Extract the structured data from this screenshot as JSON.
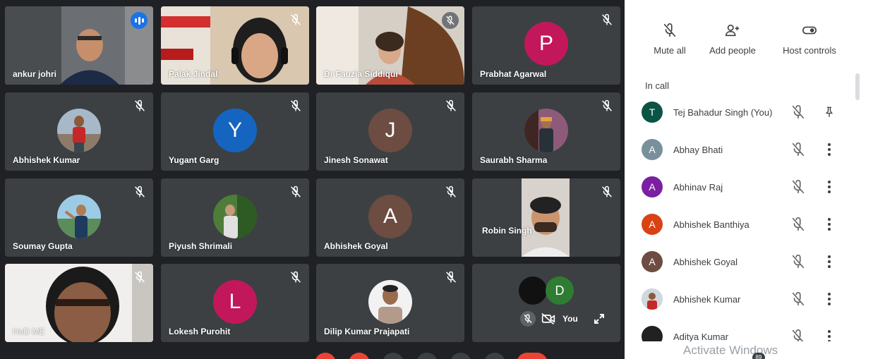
{
  "tiles": [
    {
      "name": "ankur johri",
      "kind": "video",
      "active": true
    },
    {
      "name": "Palak Jindal",
      "kind": "video"
    },
    {
      "name": "Dr Fauzia Siddiqui",
      "kind": "video"
    },
    {
      "name": "Prabhat Agarwal",
      "kind": "letter",
      "letter": "P",
      "color": "#c2185b"
    },
    {
      "name": "Abhishek Kumar",
      "kind": "photo"
    },
    {
      "name": "Yugant Garg",
      "kind": "letter",
      "letter": "Y",
      "color": "#1565c0"
    },
    {
      "name": "Jinesh Sonawat",
      "kind": "letter",
      "letter": "J",
      "color": "#6d4c41"
    },
    {
      "name": "Saurabh Sharma",
      "kind": "photo"
    },
    {
      "name": "Soumay Gupta",
      "kind": "photo"
    },
    {
      "name": "Piyush Shrimali",
      "kind": "photo"
    },
    {
      "name": "Abhishek Goyal",
      "kind": "letter",
      "letter": "A",
      "color": "#6d4c41"
    },
    {
      "name": "Robin Singh",
      "kind": "video"
    },
    {
      "name": "HoD ME",
      "kind": "video"
    },
    {
      "name": "Lokesh Purohit",
      "kind": "letter",
      "letter": "L",
      "color": "#c2185b"
    },
    {
      "name": "Dilip Kumar Prajapati",
      "kind": "photo"
    },
    {
      "name": "You",
      "kind": "self",
      "letter": "D",
      "color": "#2e7d32"
    }
  ],
  "panel": {
    "actions": {
      "mute_all": "Mute all",
      "add_people": "Add people",
      "host_controls": "Host controls"
    },
    "in_call_label": "In call",
    "participants": [
      {
        "name": "Tej Bahadur Singh (You)",
        "letter": "T",
        "color": "#0b5345",
        "trailing": "pin-icon"
      },
      {
        "name": "Abhay Bhati",
        "letter": "A",
        "color": "#78909c",
        "trailing": "more-icon"
      },
      {
        "name": "Abhinav Raj",
        "letter": "A",
        "color": "#7b1fa2",
        "trailing": "more-icon"
      },
      {
        "name": "Abhishek Banthiya",
        "letter": "A",
        "color": "#d84315",
        "trailing": "more-icon"
      },
      {
        "name": "Abhishek Goyal",
        "letter": "A",
        "color": "#6d4c41",
        "trailing": "more-icon"
      },
      {
        "name": "Abhishek Kumar",
        "letter": "",
        "color": "#90a4ae",
        "trailing": "more-icon"
      },
      {
        "name": "Aditya Kumar",
        "letter": "",
        "color": "#212121",
        "trailing": "more-icon"
      }
    ]
  },
  "overlay": {
    "activate_windows": "Activate Windows",
    "badge": "89"
  },
  "colors": {
    "accent": "#1a73e8",
    "active_outline": "#8ab4f8",
    "tile_bg": "#3c4043",
    "stage_bg": "#202124"
  }
}
